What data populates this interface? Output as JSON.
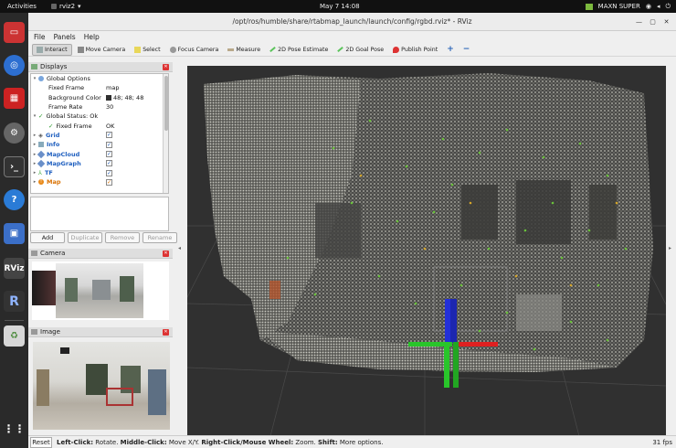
{
  "topbar": {
    "activities": "Activities",
    "app_name": "rviz2",
    "clock": "May 7  14:08",
    "power_mode": "MAXN SUPER"
  },
  "window": {
    "title": "/opt/ros/humble/share/rtabmap_launch/launch/config/rgbd.rviz* - RViz"
  },
  "menu": [
    "File",
    "Panels",
    "Help"
  ],
  "toolbar": [
    {
      "label": "Interact",
      "icon": "interact-icon",
      "active": true
    },
    {
      "label": "Move Camera",
      "icon": "move-camera-icon"
    },
    {
      "label": "Select",
      "icon": "select-icon"
    },
    {
      "label": "Focus Camera",
      "icon": "focus-camera-icon"
    },
    {
      "label": "Measure",
      "icon": "measure-icon"
    },
    {
      "label": "2D Pose Estimate",
      "icon": "pose-estimate-icon"
    },
    {
      "label": "2D Goal Pose",
      "icon": "goal-pose-icon"
    },
    {
      "label": "Publish Point",
      "icon": "publish-point-icon"
    }
  ],
  "displays": {
    "title": "Displays",
    "global_options": "Global Options",
    "fixed_frame_label": "Fixed Frame",
    "fixed_frame_value": "map",
    "background_label": "Background Color",
    "background_value": "48; 48; 48",
    "frame_rate_label": "Frame Rate",
    "frame_rate_value": "30",
    "global_status": "Global Status: Ok",
    "status_fixed_frame_label": "Fixed Frame",
    "status_fixed_frame_value": "OK",
    "items": [
      "Grid",
      "Info",
      "MapCloud",
      "MapGraph",
      "TF",
      "Map"
    ],
    "buttons": {
      "add": "Add",
      "duplicate": "Duplicate",
      "remove": "Remove",
      "rename": "Rename"
    }
  },
  "camera_panel": {
    "title": "Camera"
  },
  "image_panel": {
    "title": "Image"
  },
  "status": {
    "reset": "Reset",
    "left_click": "Left-Click:",
    "left_text": " Rotate. ",
    "middle_click": "Middle-Click:",
    "middle_text": " Move X/Y. ",
    "right_click": "Right-Click/Mouse Wheel:",
    "right_text": " Zoom. ",
    "shift": "Shift:",
    "shift_text": " More options.",
    "fps": "31 fps"
  },
  "colors": {
    "viewport_bg": "#303030",
    "accent": "#2a64b8"
  }
}
